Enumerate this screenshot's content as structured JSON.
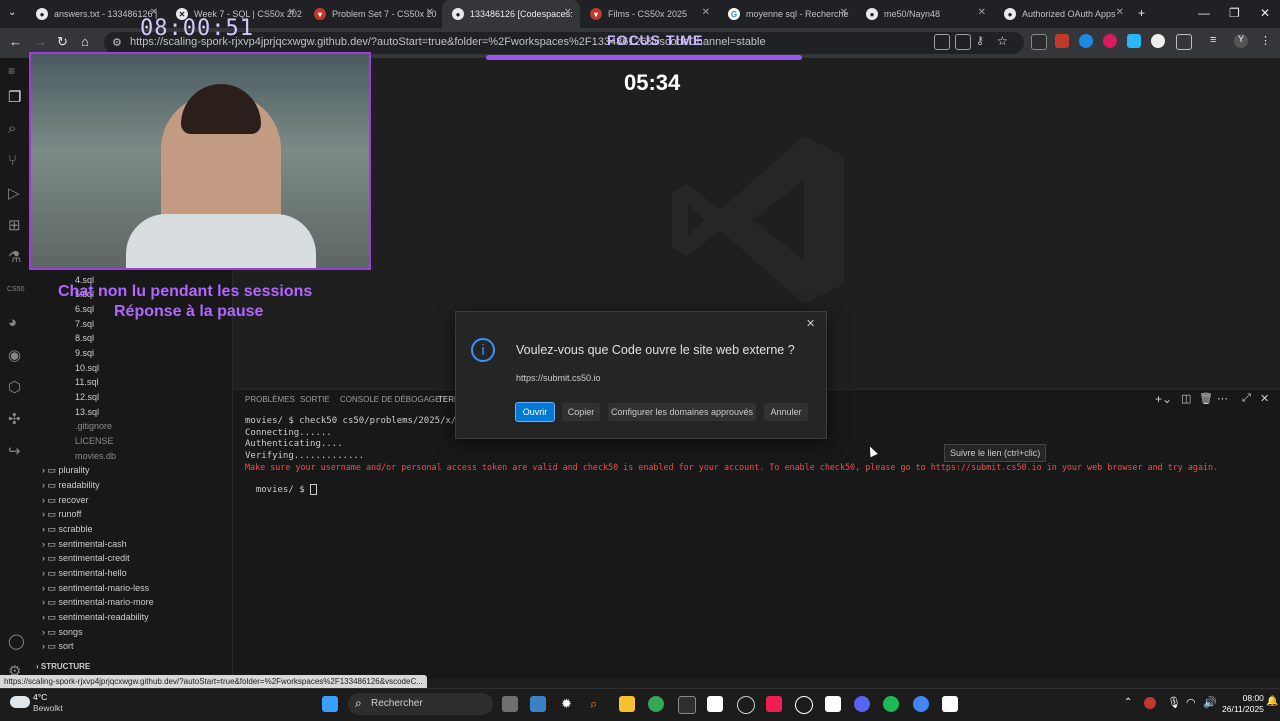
{
  "browser": {
    "tabs": [
      {
        "label": "answers.txt - 133486126 |",
        "icon": "github-icon",
        "active": false
      },
      {
        "label": "Week 7 - SQL | CS50x 202",
        "icon": "cs50-icon",
        "active": false
      },
      {
        "label": "Problem Set 7 - CS50x 20",
        "icon": "cs50-shield-icon",
        "active": false
      },
      {
        "label": "133486126 [Codespaces:",
        "icon": "github-icon",
        "active": true
      },
      {
        "label": "Films - CS50x 2025",
        "icon": "cs50-shield-icon",
        "active": false
      },
      {
        "label": "moyenne sql - Recherche",
        "icon": "google-icon",
        "active": false
      },
      {
        "label": "me50/Nayn48",
        "icon": "github-icon",
        "active": false
      },
      {
        "label": "Authorized OAuth Apps",
        "icon": "github-icon",
        "active": false
      }
    ],
    "url": "https://scaling-spork-rjxvp4jprjqcxwgw.github.dev/?autoStart=true&folder=%2Fworkspaces%2F133486126&vscodeChannel=stable"
  },
  "stream_overlay": {
    "timer": "08:00:51",
    "focus_label": "FOCUS TIME",
    "countdown": "05:34",
    "focus_progress": 1.0,
    "chat_note_line1": "Chat non lu pendant les sessions",
    "chat_note_line2": "Réponse à la pause"
  },
  "explorer": {
    "files": [
      "4.sql",
      "5.sql",
      "6.sql",
      "7.sql",
      "8.sql",
      "9.sql",
      "10.sql",
      "11.sql",
      "12.sql",
      "13.sql"
    ],
    "dim_files": [
      ".gitignore",
      "LICENSE",
      "movies.db"
    ],
    "folders": [
      "plurality",
      "readability",
      "recover",
      "runoff",
      "scrabble",
      "sentimental-cash",
      "sentimental-credit",
      "sentimental-hello",
      "sentimental-mario-less",
      "sentimental-mario-more",
      "sentimental-readability",
      "songs",
      "sort"
    ],
    "section": "STRUCTURE",
    "cs50_label": "CS50"
  },
  "panel": {
    "tabs": [
      "PROBLÈMES",
      "SORTIE",
      "CONSOLE DE DÉBOGAGE",
      "TERM"
    ],
    "terminal_lines": [
      "movies/ $ check50 cs50/problems/2025/x/mo",
      "Connecting......",
      "Authenticating....",
      "Verifying............."
    ],
    "terminal_error": "Make sure your username and/or personal access token are valid and check50 is enabled for your account. To enable check50, please go to https://submit.cs50.io in your web browser and try again.",
    "prompt": "movies/ $ "
  },
  "dialog": {
    "title": "Voulez-vous que Code ouvre le site web externe ?",
    "url": "https://submit.cs50.io",
    "buttons": {
      "open": "Ouvrir",
      "copy": "Copier",
      "configure": "Configurer les domaines approuvés",
      "cancel": "Annuler"
    }
  },
  "tooltip": {
    "text": "Suivre le lien (ctrl+clic)"
  },
  "status_url": "https://scaling-spork-rjxvp4jprjqcxwgw.github.dev/?autoStart=true&folder=%2Fworkspaces%2F133486126&vscodeC...",
  "taskbar": {
    "weather_temp": "4°C",
    "weather_desc": "Bewolkt",
    "search_placeholder": "Rechercher",
    "time": "08:00",
    "date": "26/11/2025"
  }
}
